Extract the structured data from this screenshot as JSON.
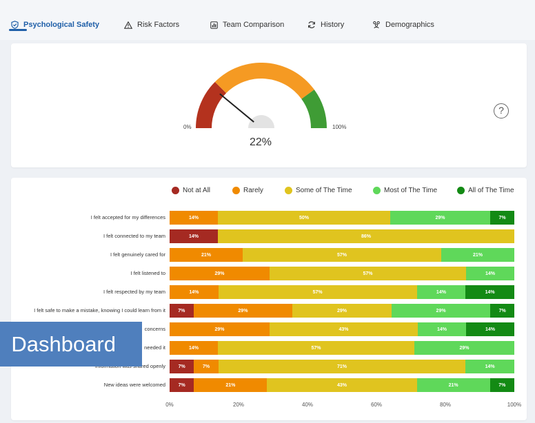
{
  "tabs": [
    {
      "label": "Psychological Safety",
      "icon": "shield-check-icon",
      "active": true
    },
    {
      "label": "Risk Factors",
      "icon": "warning-triangle-icon",
      "active": false
    },
    {
      "label": "Team Comparison",
      "icon": "bar-chart-icon",
      "active": false
    },
    {
      "label": "History",
      "icon": "refresh-icon",
      "active": false
    },
    {
      "label": "Demographics",
      "icon": "people-icon",
      "active": false
    }
  ],
  "gauge": {
    "value": 0.22,
    "value_label": "22%",
    "min_label": "0%",
    "max_label": "100%",
    "bands": [
      {
        "from": 0,
        "to": 0.25,
        "color": "#b4321e"
      },
      {
        "from": 0.25,
        "to": 0.8,
        "color": "#f59a23"
      },
      {
        "from": 0.8,
        "to": 1.0,
        "color": "#3f9c35"
      }
    ]
  },
  "help": {
    "label": "?"
  },
  "chart_data": {
    "type": "bar",
    "orientation": "horizontal",
    "stacked": true,
    "categories": [
      "I felt accepted for my differences",
      "I felt connected to my team",
      "I felt genuinely cared for",
      "I felt listened to",
      "I felt respected by my team",
      "I felt safe to make a mistake, knowing I could learn from it",
      "concerns",
      "needed it",
      "Information was shared openly",
      "New ideas were welcomed"
    ],
    "series": [
      {
        "name": "Not at All",
        "color": "#a52a22",
        "values": [
          0,
          14,
          0,
          0,
          0,
          7,
          0,
          0,
          7,
          7
        ]
      },
      {
        "name": "Rarely",
        "color": "#f08a00",
        "values": [
          14,
          0,
          21,
          29,
          14,
          29,
          29,
          14,
          7,
          21
        ]
      },
      {
        "name": "Some of The Time",
        "color": "#e0c41f",
        "values": [
          50,
          86,
          57,
          57,
          57,
          29,
          43,
          57,
          71,
          43
        ]
      },
      {
        "name": "Most of The Time",
        "color": "#5fd85a",
        "values": [
          29,
          0,
          21,
          14,
          14,
          29,
          14,
          29,
          14,
          21
        ]
      },
      {
        "name": "All of The Time",
        "color": "#138a14",
        "values": [
          7,
          0,
          0,
          0,
          14,
          7,
          14,
          0,
          0,
          7
        ]
      }
    ],
    "xlim": [
      0,
      100
    ],
    "xticks": [
      "0%",
      "20%",
      "40%",
      "60%",
      "80%",
      "100%"
    ]
  },
  "overlay": {
    "label": "Dashboard"
  }
}
